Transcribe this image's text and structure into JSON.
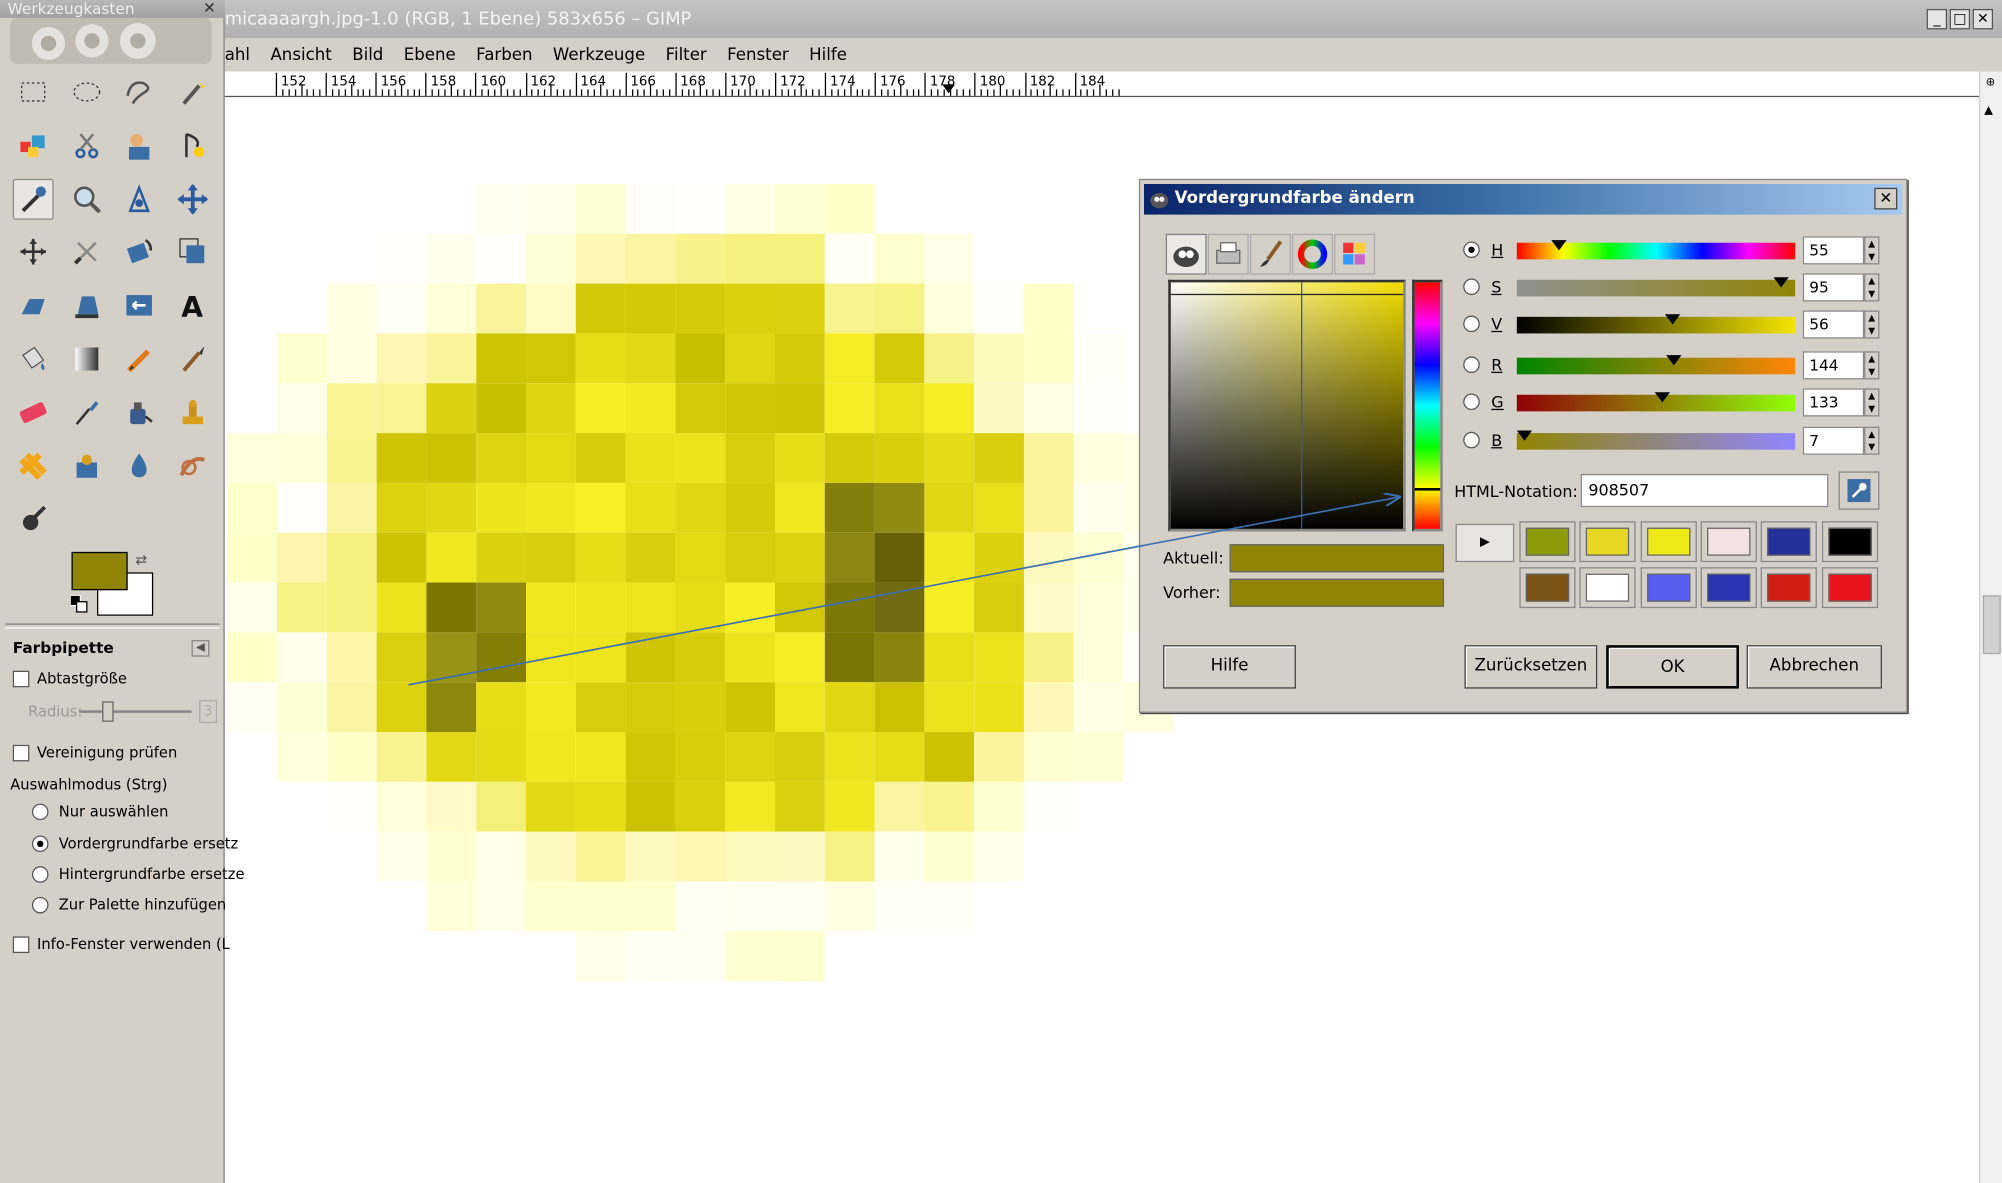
{
  "toolbox": {
    "title": "Werkzeugkasten",
    "close": "✕",
    "tool_options_title": "Farbpipette",
    "sample_size_label": "Abtastgröße",
    "radius_label": "Radius:",
    "radius_value": "3",
    "sample_merged_label": "Vereinigung prüfen",
    "pick_mode_label": "Auswahlmodus (Strg)",
    "mode_options": [
      "Nur auswählen",
      "Vordergrundfarbe ersetz",
      "Hintergrundfarbe ersetze",
      "Zur Palette hinzufügen"
    ],
    "mode_selected": 1,
    "info_window_label": "Info-Fenster verwenden (L",
    "fg_color": "#908507",
    "bg_color": "#ffffff"
  },
  "window": {
    "title": "micaaaargh.jpg-1.0 (RGB, 1 Ebene) 583x656 – GIMP",
    "minimize": "_",
    "maximize": "□",
    "close": "✕"
  },
  "menu": [
    "ahl",
    "Ansicht",
    "Bild",
    "Ebene",
    "Farben",
    "Werkzeuge",
    "Filter",
    "Fenster",
    "Hilfe"
  ],
  "ruler": {
    "labels": [
      "152",
      "154",
      "156",
      "158",
      "160",
      "162",
      "164",
      "166",
      "168",
      "170",
      "172",
      "174",
      "176",
      "178",
      "180",
      "182",
      "184"
    ]
  },
  "dialog": {
    "title": "Vordergrundfarbe ändern",
    "close": "✕",
    "sliders": [
      {
        "label": "H",
        "value": "55",
        "selected": true
      },
      {
        "label": "S",
        "value": "95",
        "selected": false
      },
      {
        "label": "V",
        "value": "56",
        "selected": false
      },
      {
        "label": "R",
        "value": "144",
        "selected": false
      },
      {
        "label": "G",
        "value": "133",
        "selected": false
      },
      {
        "label": "B",
        "value": "7",
        "selected": false
      }
    ],
    "html_label": "HTML-Notation:",
    "html_value": "908507",
    "current_label": "Aktuell:",
    "previous_label": "Vorher:",
    "current_color": "#908507",
    "previous_color": "#908507",
    "history_colors": [
      "#8f9a08",
      "#e6d822",
      "#eeea1a",
      "#f2e2e0",
      "#24309a",
      "#000000",
      "#7c5416",
      "#ffffff",
      "#5a5ef0",
      "#2a34b0",
      "#d21e14",
      "#e8141c"
    ],
    "buttons": {
      "help": "Hilfe",
      "reset": "Zurücksetzen",
      "ok": "OK",
      "cancel": "Abbrechen"
    }
  }
}
